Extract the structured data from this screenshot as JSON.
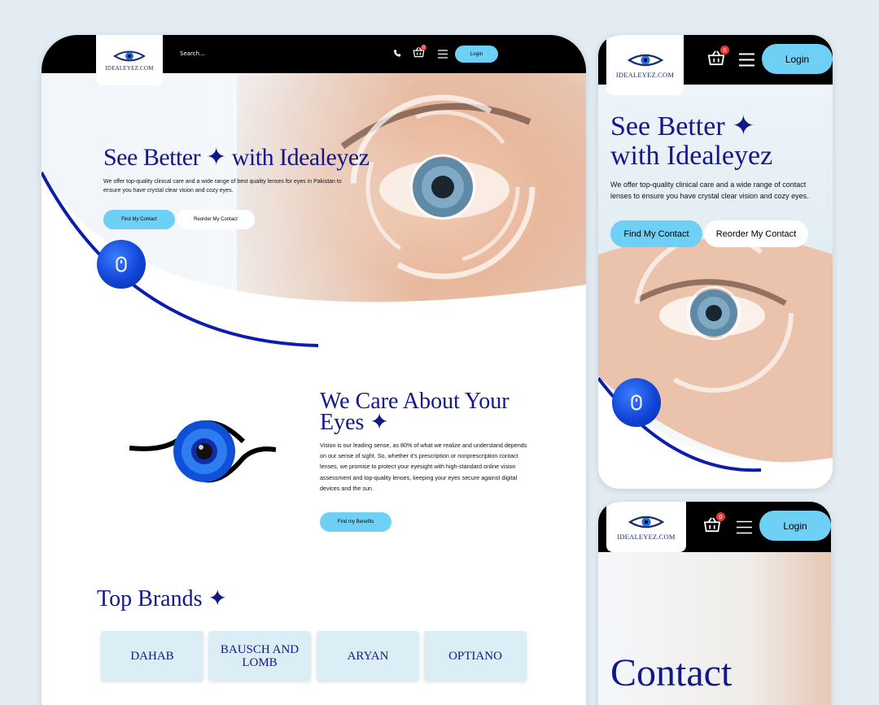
{
  "brand": {
    "logo_text": "IDEALEYEZ.COM",
    "primary": "#12188a",
    "accent": "#6fd0f5",
    "badge": "#e53935"
  },
  "desktop": {
    "search_placeholder": "Search...",
    "login_label": "Login",
    "cart_count": "0",
    "hero": {
      "title": "See Better ✦ with Idealeyez",
      "description": "We offer top-quality clinical care and a wide range of best quality lenses for eyes in Pakistan to ensure you have crystal clear vision and cozy eyes.",
      "primary_button": "Find My Contact",
      "secondary_button": "Reorder My Contact"
    },
    "care": {
      "title": "We Care About Your Eyes ✦",
      "text": "Vision is our leading sense, as 80% of what we realize and understand depends on our sense of sight. So, whether it’s prescription or nonprescription contact lenses, we promise to protect your eyesight with high-standard online vision assessment and top-quality lenses, keeping your eyes secure against digital devices and the sun.",
      "button": "Find my Benefits"
    },
    "brands": {
      "title": "Top Brands ✦",
      "items": [
        "DAHAB",
        "BAUSCH AND LOMB",
        "ARYAN",
        "OPTIANO"
      ]
    }
  },
  "mobile1": {
    "login_label": "Login",
    "cart_count": "0",
    "title_line1": "See Better ✦",
    "title_line2": "with Idealeyez",
    "description": "We offer top-quality clinical care and a wide range of contact lenses to ensure you have crystal clear vision and cozy eyes.",
    "primary_button": "Find My Contact",
    "secondary_button": "Reorder My Contact"
  },
  "mobile2": {
    "login_label": "Login",
    "cart_count": "0",
    "heading": "Contact"
  },
  "icons": [
    "phone-icon",
    "basket-icon",
    "menu-icon",
    "mouse-scroll-icon",
    "eye-logo-icon",
    "sparkle-icon"
  ]
}
